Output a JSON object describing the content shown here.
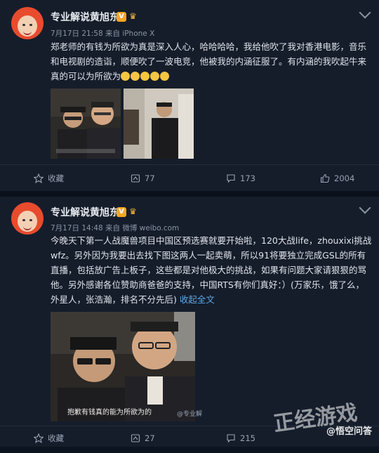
{
  "posts": [
    {
      "username": "专业解说黄旭东",
      "meta": "7月17日 21:58 来自 iPhone X",
      "text": "郑老师的有钱为所欲为真是深入人心，哈哈哈哈，我给他吹了我对香港电影，音乐和电视剧的造诣，顺便吹了一波电竞，他被我的内涵征服了。有内涵的我吹起牛来真的可以为所欲为",
      "favorite": "收藏",
      "reposts": "77",
      "comments": "173",
      "likes": "2004"
    },
    {
      "username": "专业解说黄旭东",
      "meta": "7月17日 14:48 来自 微博 weibo.com",
      "text": "今晚天下第一人战魔兽项目中国区预选赛就要开始啦，120大战life，zhouxixi挑战wfz。另外因为我要出去找下图这两人一起卖萌，所以91将要独立完成GSL的所有直播，包括放广告上板子，这些都是对他极大的挑战，如果有问题大家请狠狠的骂他。另外感谢各位赞助商爸爸的支持，中国RTS有你们真好：）(万家乐，饿了么，外星人，张浩瀚，排名不分先后)",
      "collapse": "收起全文",
      "image_caption": "抱歉有钱真的能为所欲为的",
      "image_credit": "@专业解",
      "favorite": "收藏",
      "reposts": "27",
      "comments": "215"
    }
  ],
  "watermark": "@悟空问答",
  "icons": [
    "chevron-down-icon",
    "star-icon",
    "repost-icon",
    "comment-icon",
    "like-icon",
    "verified-v-icon",
    "crown-icon"
  ]
}
